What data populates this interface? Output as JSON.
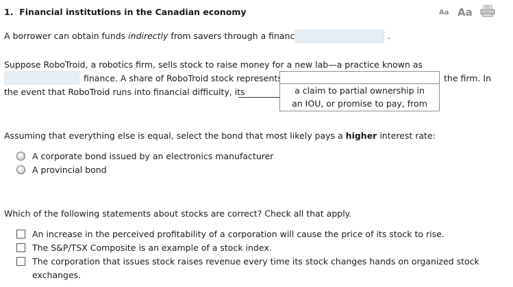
{
  "question": {
    "number": "1.",
    "title": "Financial institutions in the Canadian economy"
  },
  "font_controls": {
    "small": "Aa",
    "large": "Aa",
    "print_icon": "printer-icon"
  },
  "part1": {
    "text_before": "A borrower can obtain funds ",
    "text_italic": "indirectly",
    "text_after": " from savers through a financial",
    "blank_value": "",
    "period": "."
  },
  "part2": {
    "line1": "Suppose RoboTroid, a robotics firm, sells stock to raise money for a new lab—a practice known as",
    "blank_value": "",
    "line2_mid": "finance. A share of RoboTroid stock represents",
    "line2_end": "the firm. In",
    "line3": "the event that RoboTroid runs into financial difficulty, its",
    "dropdown_options": [
      "a claim to partial ownership in",
      "an IOU, or promise to pay, from"
    ]
  },
  "part3": {
    "prompt_before": "Assuming that everything else is equal, select the bond that most likely pays a ",
    "prompt_bold": "higher",
    "prompt_after": " interest rate:",
    "options": [
      "A corporate bond issued by an electronics manufacturer",
      "A provincial bond"
    ]
  },
  "part4": {
    "prompt": "Which of the following statements about stocks are correct? Check all that apply.",
    "options": [
      "An increase in the perceived profitability of a corporation will cause the price of its stock to rise.",
      "The S&P/TSX Composite is an example of a stock index.",
      "The corporation that issues stock raises revenue every time its stock changes hands on organized stock",
      "exchanges."
    ]
  }
}
